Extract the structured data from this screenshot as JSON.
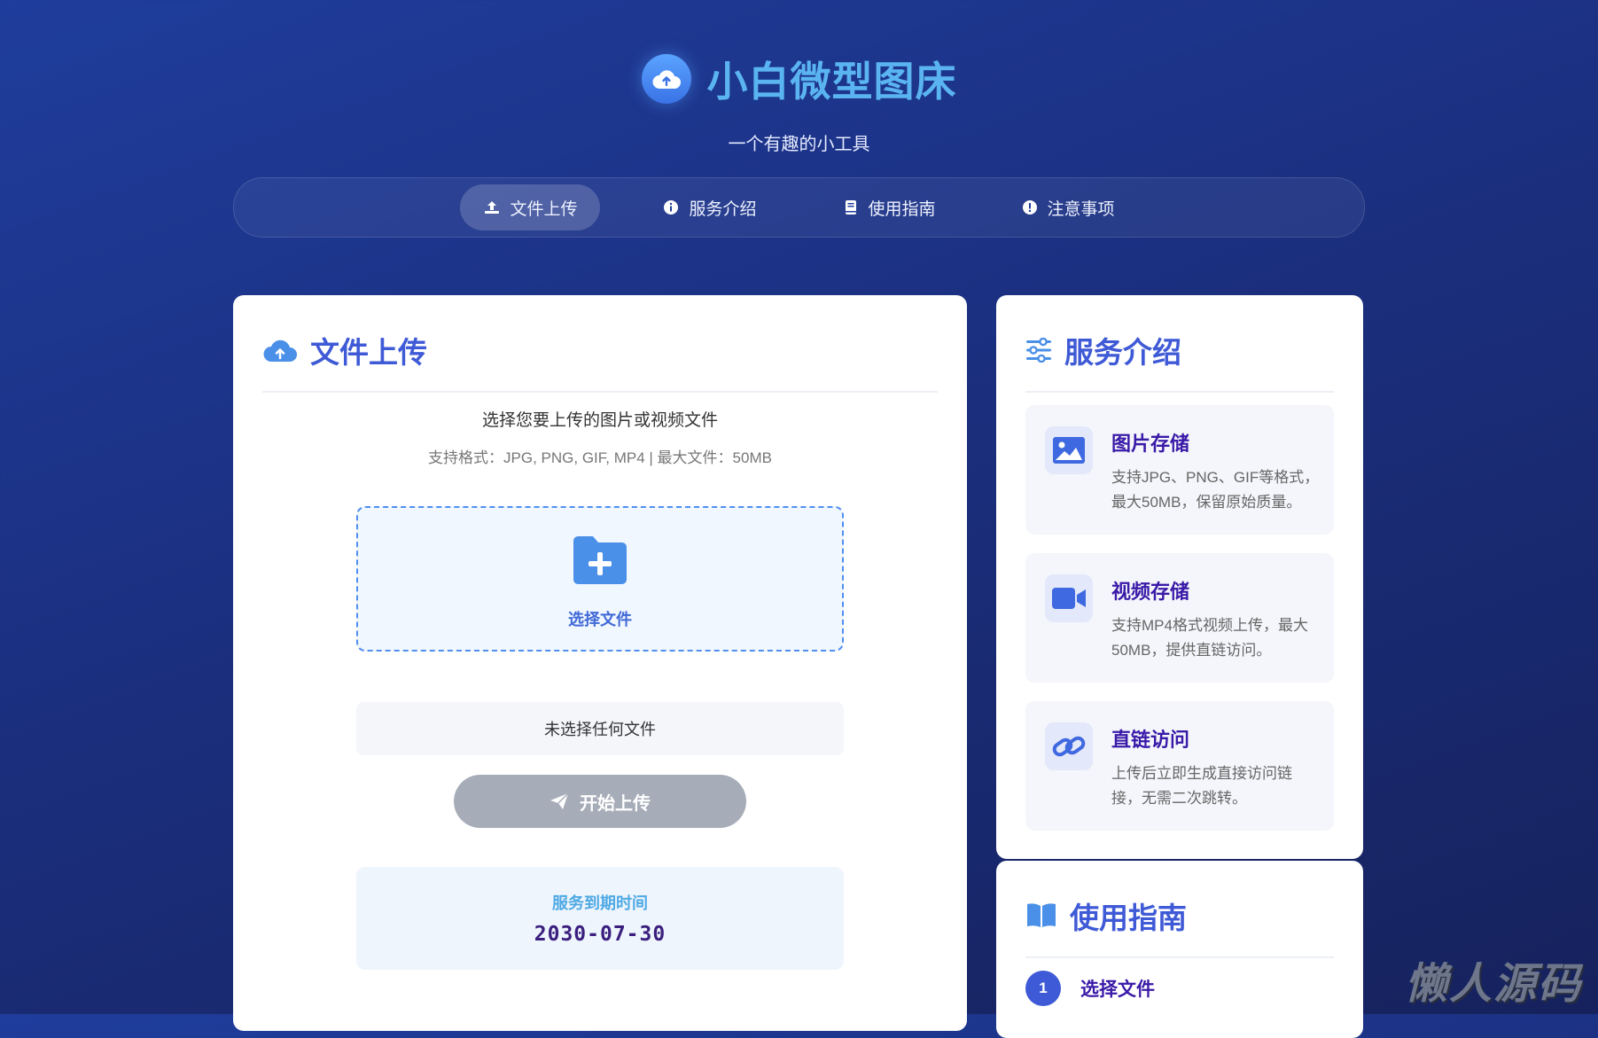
{
  "brand": {
    "title": "小白微型图床",
    "subtitle": "一个有趣的小工具"
  },
  "nav": {
    "items": [
      {
        "label": "文件上传",
        "icon": "upload-icon",
        "active": true
      },
      {
        "label": "服务介绍",
        "icon": "info-icon",
        "active": false
      },
      {
        "label": "使用指南",
        "icon": "book-icon",
        "active": false
      },
      {
        "label": "注意事项",
        "icon": "alert-icon",
        "active": false
      }
    ]
  },
  "upload": {
    "title": "文件上传",
    "lead": "选择您要上传的图片或视频文件",
    "spec": "支持格式：JPG, PNG, GIF, MP4 | 最大文件：50MB",
    "dropzone_label": "选择文件",
    "no_file_text": "未选择任何文件",
    "button_label": "开始上传",
    "expire_label": "服务到期时间",
    "expire_date": "2030-07-30"
  },
  "services": {
    "title": "服务介绍",
    "features": [
      {
        "title": "图片存储",
        "desc": "支持JPG、PNG、GIF等格式，最大50MB，保留原始质量。",
        "icon": "image-icon"
      },
      {
        "title": "视频存储",
        "desc": "支持MP4格式视频上传，最大50MB，提供直链访问。",
        "icon": "video-icon"
      },
      {
        "title": "直链访问",
        "desc": "上传后立即生成直接访问链接，无需二次跳转。",
        "icon": "link-icon"
      }
    ]
  },
  "guide": {
    "title": "使用指南",
    "steps": [
      {
        "num": "1",
        "label": "选择文件"
      }
    ]
  },
  "watermark": "懒人源码",
  "colors": {
    "accent": "#3f5ad6",
    "brand_title": "#5ab4f0",
    "feature_title": "#3a1aa8",
    "background": "#1f3d9c"
  }
}
